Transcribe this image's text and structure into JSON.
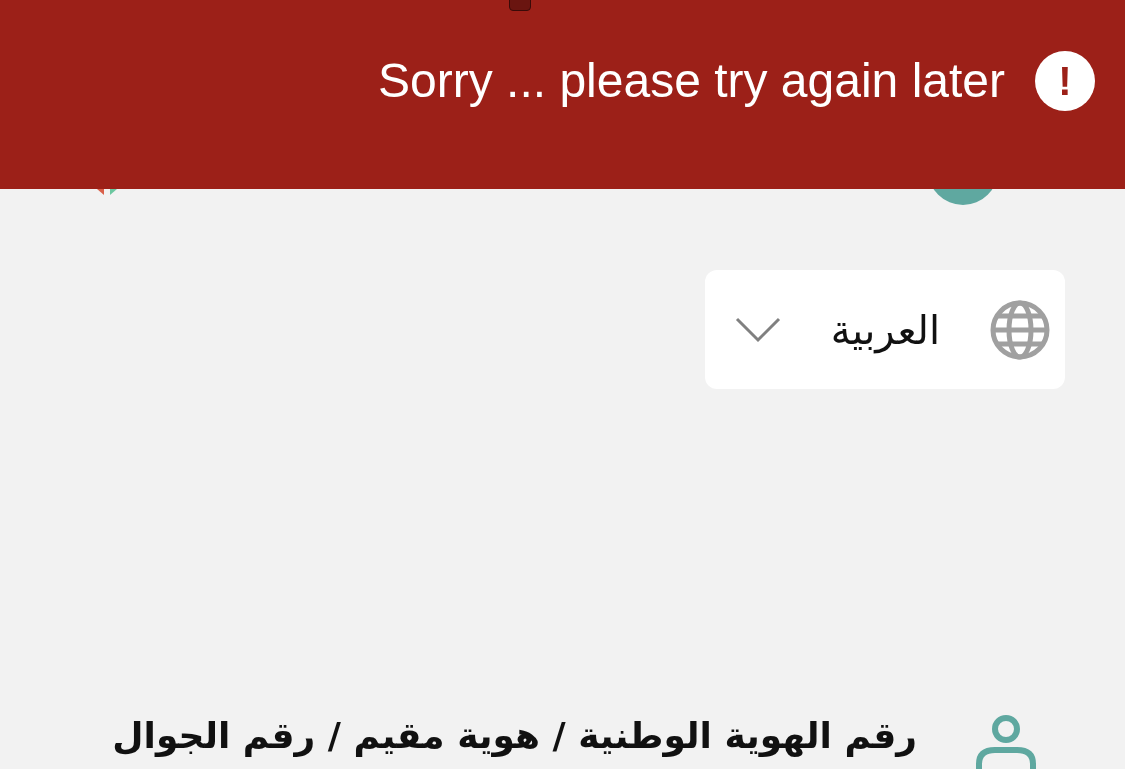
{
  "banner": {
    "message": "Sorry ... please try again later",
    "icon_text": "!"
  },
  "language_select": {
    "value": "العربية"
  },
  "id_field": {
    "label": "رقم الهوية الوطنية / هوية مقيم / رقم الجوال"
  }
}
